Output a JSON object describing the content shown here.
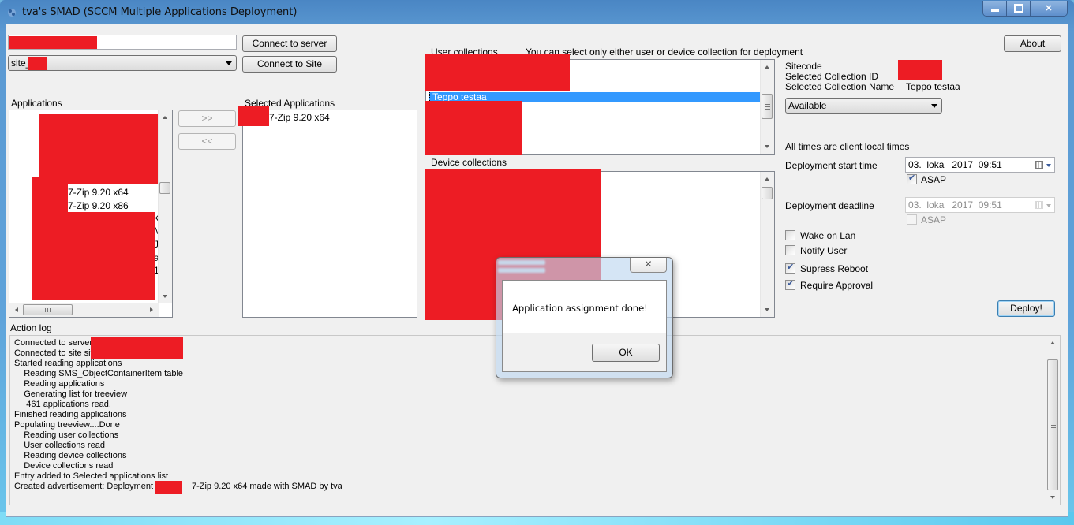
{
  "window": {
    "title": "tva's SMAD (SCCM Multiple Applications Deployment)",
    "caption_buttons": {
      "minimize": "—",
      "maximize": "□",
      "close": "✕"
    }
  },
  "connection": {
    "server_value": "",
    "site_value": "site_",
    "connect_server_label": "Connect to server",
    "connect_site_label": "Connect to Site"
  },
  "about_label": "About",
  "applications": {
    "label": "Applications",
    "visible_items": [
      "7-Zip 9.20 x64",
      "7-Zip 9.20 x86"
    ],
    "clipped_chars": [
      "k",
      "M",
      "J",
      "a",
      "1"
    ]
  },
  "transfer": {
    "add_label": ">>",
    "remove_label": "<<"
  },
  "selected_applications": {
    "label": "Selected Applications",
    "items": [
      "7-Zip 9.20 x64"
    ]
  },
  "user_collections": {
    "label": "User collections",
    "hint": "You can select only either user or device collection for deployment",
    "selected_item": "Teppo testaa"
  },
  "device_collections": {
    "label": "Device collections"
  },
  "info": {
    "sitecode_label": "Sitecode",
    "collection_id_label": "Selected Collection ID",
    "collection_name_label": "Selected Collection Name",
    "collection_name_value": "Teppo testaa",
    "purpose_value": "Available",
    "times_note": "All times are client local times"
  },
  "deployment": {
    "start_label": "Deployment start time",
    "start_value": "03.  loka   2017  09:51",
    "start_asap_label": "ASAP",
    "start_asap_checked": true,
    "deadline_label": "Deployment deadline",
    "deadline_value": "03.  loka   2017  09:51",
    "deadline_asap_label": "ASAP",
    "deadline_asap_checked": false
  },
  "options": [
    {
      "label": "Wake on Lan",
      "checked": false
    },
    {
      "label": "Notify User",
      "checked": false
    },
    {
      "label": "Supress Reboot",
      "checked": true
    },
    {
      "label": "Require Approval",
      "checked": true
    }
  ],
  "deploy_label": "Deploy!",
  "action_log": {
    "label": "Action log",
    "lines": [
      "Connected to server",
      "Connected to site sit",
      "Started reading applications",
      "    Reading SMS_ObjectContainerItem table",
      "    Reading applications",
      "    Generating list for treeview",
      "     461 applications read.",
      "Finished reading applications",
      "Populating treeview....Done",
      "    Reading user collections",
      "    User collections read",
      "    Reading device collections",
      "    Device collections read",
      "Entry added to Selected applications list",
      "Created advertisement: Deployment of            7-Zip 9.20 x64 made with SMAD by tva"
    ]
  },
  "dialog": {
    "message": "Application assignment done!",
    "ok_label": "OK",
    "close_glyph": "✕"
  },
  "colors": {
    "redaction": "#ed1c24",
    "selection": "#3399ff"
  }
}
